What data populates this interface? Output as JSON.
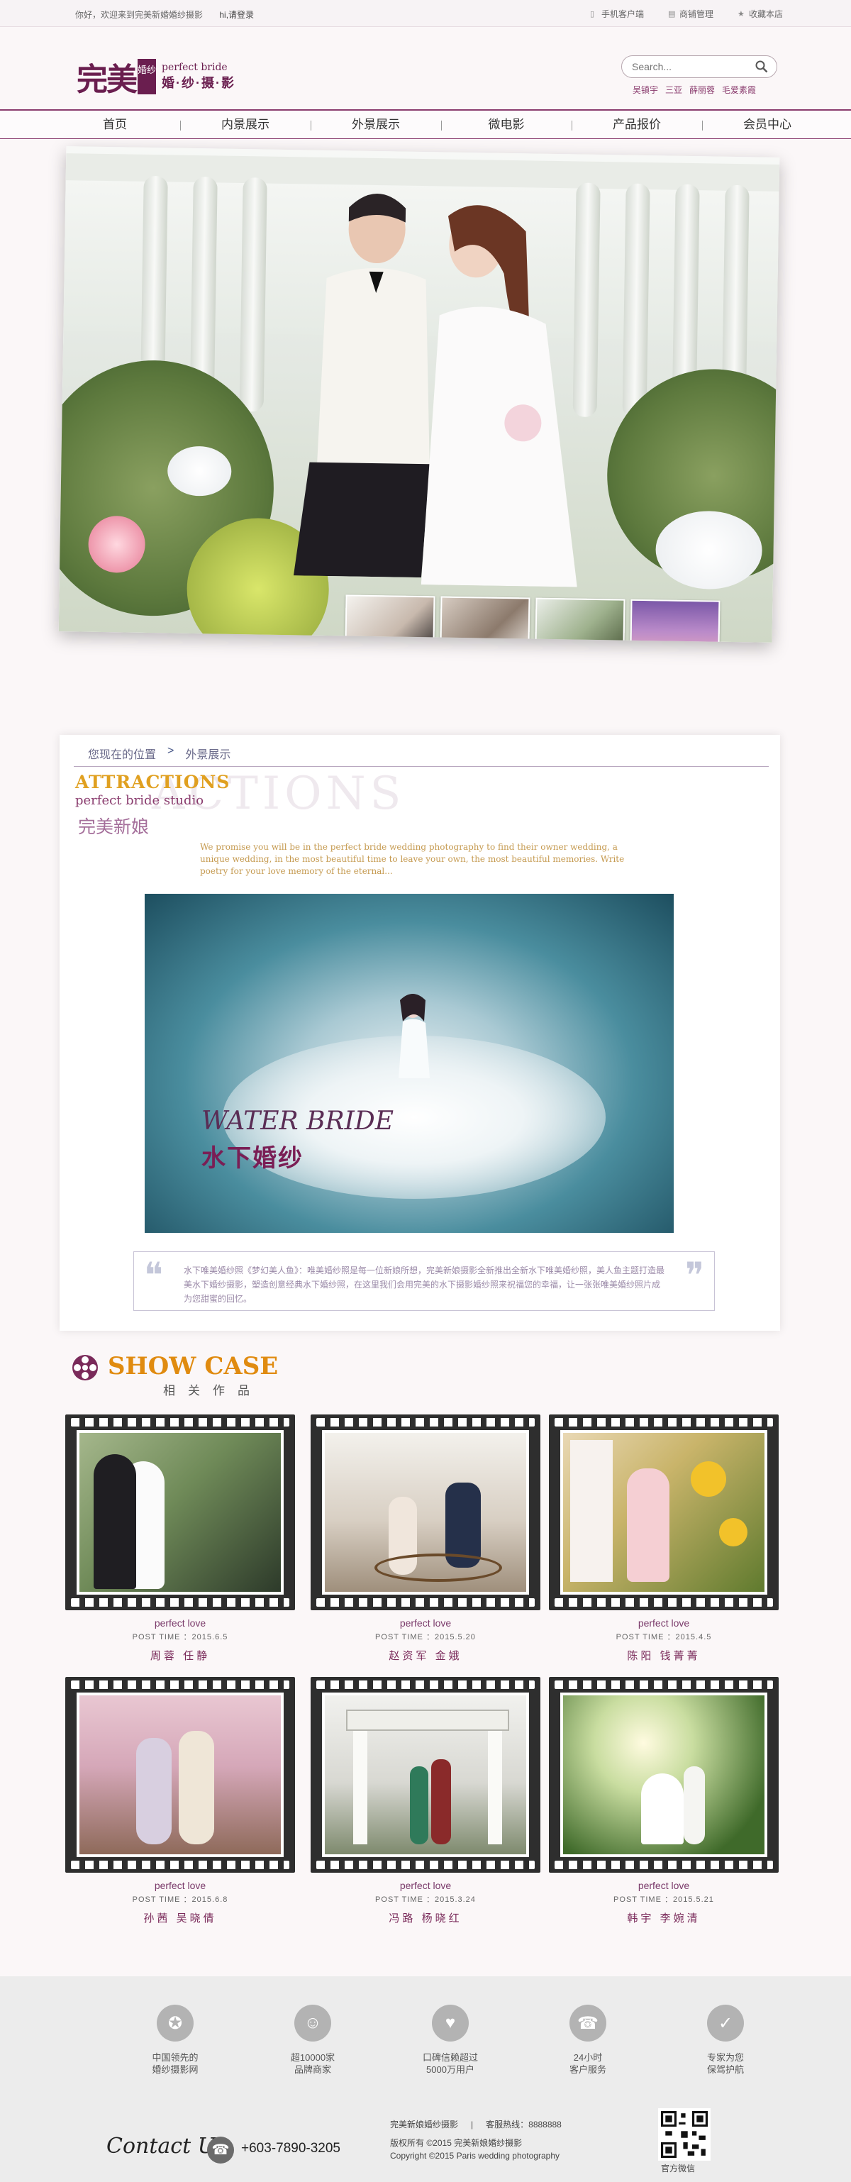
{
  "topbar": {
    "welcome": "你好，欢迎来到完美新婚婚纱摄影",
    "login": "hi,请登录",
    "links": [
      "手机客户端",
      "商铺管理",
      "收藏本店"
    ]
  },
  "logo": {
    "main": "完美",
    "badge": "婚纱",
    "en": "perfect bride",
    "cn": "婚·纱·摄·影"
  },
  "search": {
    "placeholder": "Search...",
    "hot": [
      "吴镇宇",
      "三亚",
      "薛丽蓉",
      "毛爱素霞"
    ]
  },
  "nav": [
    "首页",
    "内景展示",
    "外景展示",
    "微电影",
    "产品报价",
    "会员中心"
  ],
  "breadcrumb": {
    "label": "您现在的位置",
    "sep": ">",
    "current": "外景展示"
  },
  "attractions": {
    "bg_text": "ACTIONS",
    "title": "ATTRACTIONS",
    "subtitle": "perfect bride studio",
    "cn_title": "完美新娘",
    "intro": "We promise you will be in the perfect bride wedding photography to find their owner wedding, a unique wedding, in the most beautiful time to leave your own, the most beautiful memories. Write poetry for your love memory of the eternal...",
    "banner_en": "WATER BRIDE",
    "banner_cn": "水下婚纱",
    "quote": "水下唯美婚纱照《梦幻美人鱼》：唯美婚纱照是每一位新娘所想，完美新娘摄影全新推出全新水下唯美婚纱照，美人鱼主题打造最美水下婚纱摄影，塑造创意经典水下婚纱照，在这里我们会用完美的水下摄影婚纱照来祝福您的幸福，让一张张唯美婚纱照片成为您甜蜜的回忆。",
    "quote_open": "❝",
    "quote_close": "❞"
  },
  "showcase": {
    "title": "SHOW CASE",
    "subtitle": "相关作品",
    "items": [
      {
        "en": "perfect love",
        "time": "POST  TIME ：2015.6.5",
        "names": "周蓉 任静"
      },
      {
        "en": "perfect love",
        "time": "POST  TIME ：2015.5.20",
        "names": "赵资军 金娥"
      },
      {
        "en": "perfect love",
        "time": "POST  TIME ：2015.4.5",
        "names": "陈阳 钱菁菁"
      },
      {
        "en": "perfect love",
        "time": "POST  TIME ：2015.6.8",
        "names": "孙茜 吴晓倩"
      },
      {
        "en": "perfect love",
        "time": "POST  TIME ：2015.3.24",
        "names": "冯路 杨晓红"
      },
      {
        "en": "perfect love",
        "time": "POST  TIME ：2015.5.21",
        "names": "韩宇 李婉清"
      }
    ]
  },
  "footer": {
    "features": [
      {
        "icon": "medal-icon",
        "glyph": "✪",
        "line1": "中国领先的",
        "line2": "婚纱摄影网"
      },
      {
        "icon": "users-icon",
        "glyph": "☺",
        "line1": "超10000家",
        "line2": "品牌商家"
      },
      {
        "icon": "heart-icon",
        "glyph": "♥",
        "line1": "口碑信赖超过",
        "line2": "5000万用户"
      },
      {
        "icon": "headset-icon",
        "glyph": "☎",
        "line1": "24小时",
        "line2": "客户服务"
      },
      {
        "icon": "shield-icon",
        "glyph": "✓",
        "line1": "专家为您",
        "line2": "保驾护航"
      }
    ],
    "contact": "Contact Us",
    "phone": "+603-7890-3205",
    "studio": "完美新娘婚纱摄影",
    "hotline": "客服热线：8888888",
    "rights": "版权所有 ©2015 完美新娘婚纱摄影",
    "copyright": "Copyright ©2015 Paris wedding photography",
    "qr_label": "官方微信"
  }
}
